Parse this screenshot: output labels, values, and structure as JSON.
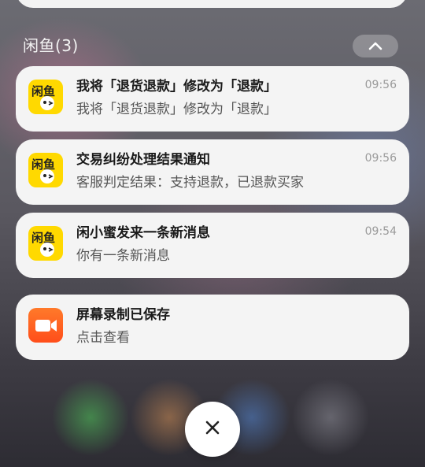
{
  "group": {
    "label": "闲鱼(3)",
    "collapse_icon": "chevron-up-icon"
  },
  "notifications": [
    {
      "app": "闲鱼",
      "icon": "xianyu-app-icon",
      "title": "我将「退货退款」修改为「退款」",
      "body": "我将「退货退款」修改为「退款」",
      "time": "09:56"
    },
    {
      "app": "闲鱼",
      "icon": "xianyu-app-icon",
      "title": "交易纠纷处理结果通知",
      "body": "客服判定结果：支持退款，已退款买家",
      "time": "09:56"
    },
    {
      "app": "闲鱼",
      "icon": "xianyu-app-icon",
      "title": "闲小蜜发来一条新消息",
      "body": "你有一条新消息",
      "time": "09:54"
    },
    {
      "app": "屏幕录制",
      "icon": "screen-recorder-app-icon",
      "title": "屏幕录制已保存",
      "body": "点击查看"
    }
  ],
  "xianyu_logo_text": "闲鱼",
  "dismiss_icon": "close-icon",
  "colors": {
    "xianyu_yellow": "#ffd900",
    "recorder_orange": "#ff6a1f",
    "card_bg": "#f4f4f4"
  }
}
